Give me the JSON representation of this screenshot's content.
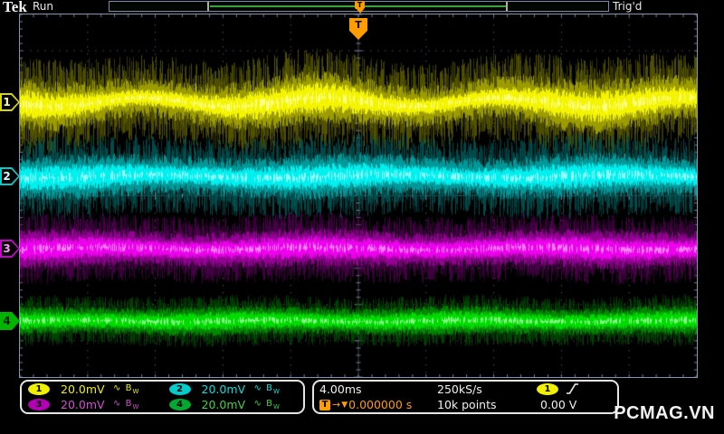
{
  "header": {
    "logo": "Tek",
    "acq_status": "Run",
    "trigger_status": "Trig'd"
  },
  "record_view": {
    "marker_label": "T",
    "line_color": "#3aa33a",
    "bracket_color": "#b5ad95",
    "accent": "#ff9d00"
  },
  "trigger_flag": {
    "label": "T",
    "color": "#ff9d00"
  },
  "channel_markers": [
    {
      "label": "1",
      "color": "#d9d900",
      "inner_color": "#000000",
      "text_color": "#ffff99"
    },
    {
      "label": "2",
      "color": "#00cccc",
      "inner_color": "#000000",
      "text_color": "#ccffff"
    },
    {
      "label": "3",
      "color": "#cc00cc",
      "inner_color": "#000000",
      "text_color": "#ff99ff"
    },
    {
      "label": "4",
      "color": "#00b400",
      "inner_color": "#00b400",
      "text_color": "#002200"
    }
  ],
  "channels": [
    {
      "number": "1",
      "scale": "20.0mV",
      "color": "#f0f000",
      "badge_bg": "#f0f000"
    },
    {
      "number": "2",
      "scale": "20.0mV",
      "color": "#00e0e0",
      "badge_bg": "#00cccc"
    },
    {
      "number": "3",
      "scale": "20.0mV",
      "color": "#d24fd2",
      "badge_bg": "#b400b4"
    },
    {
      "number": "4",
      "scale": "20.0mV",
      "color": "#3fd43f",
      "badge_bg": "#00a830"
    }
  ],
  "icons": {
    "ac_coupling": "∿",
    "bandwidth_b": "B",
    "bandwidth_w": "W"
  },
  "horizontal": {
    "scale": "4.00ms",
    "sample_rate": "250kS/s",
    "record_length": "10k points"
  },
  "trigger": {
    "source": "1",
    "source_badge_bg": "#f0f000",
    "slope": "rising",
    "delay_prefix": "T",
    "delay_arrow": "→",
    "delay_marker": "▼",
    "delay_value": "0.000000 s",
    "level": "0.00 V",
    "accent": "#ff9d00"
  },
  "watermark": "PCMAG.VN",
  "graticule": {
    "cols": 10,
    "rows": 10,
    "frame_color": "#8295b5",
    "grid_dot_color": "#46506176",
    "axis_color": "#76819a"
  },
  "waveforms": [
    {
      "name": "ch1",
      "center": 97,
      "core": 13,
      "fuzz": 38,
      "wobble_amp": 5,
      "wobble_period": 200,
      "phase": 0.5,
      "am_amp": 4,
      "am_period": 330,
      "am_phase": 2.0,
      "dim": "#565600",
      "mid": "#9c9c00",
      "bright": "#f4f400",
      "hot": "#ffffa0"
    },
    {
      "name": "ch2",
      "center": 179,
      "core": 12,
      "fuzz": 33,
      "wobble_amp": 2,
      "wobble_period": 260,
      "phase": 1.2,
      "am_amp": 2,
      "am_period": 280,
      "am_phase": 0.4,
      "dim": "#005252",
      "mid": "#009898",
      "bright": "#00efef",
      "hot": "#b0ffff"
    },
    {
      "name": "ch3",
      "center": 259,
      "core": 11,
      "fuzz": 27,
      "wobble_amp": 1.5,
      "wobble_period": 240,
      "phase": 2.4,
      "am_amp": 1.5,
      "am_period": 300,
      "am_phase": 1.1,
      "dim": "#4c004c",
      "mid": "#950095",
      "bright": "#ee00ee",
      "hot": "#ff9aff"
    },
    {
      "name": "ch4",
      "center": 339,
      "core": 9,
      "fuzz": 19,
      "wobble_amp": 1,
      "wobble_period": 220,
      "phase": 3.1,
      "am_amp": 1,
      "am_period": 260,
      "am_phase": 2.6,
      "dim": "#004800",
      "mid": "#008a00",
      "bright": "#00dc00",
      "hot": "#a0ffa0"
    }
  ]
}
